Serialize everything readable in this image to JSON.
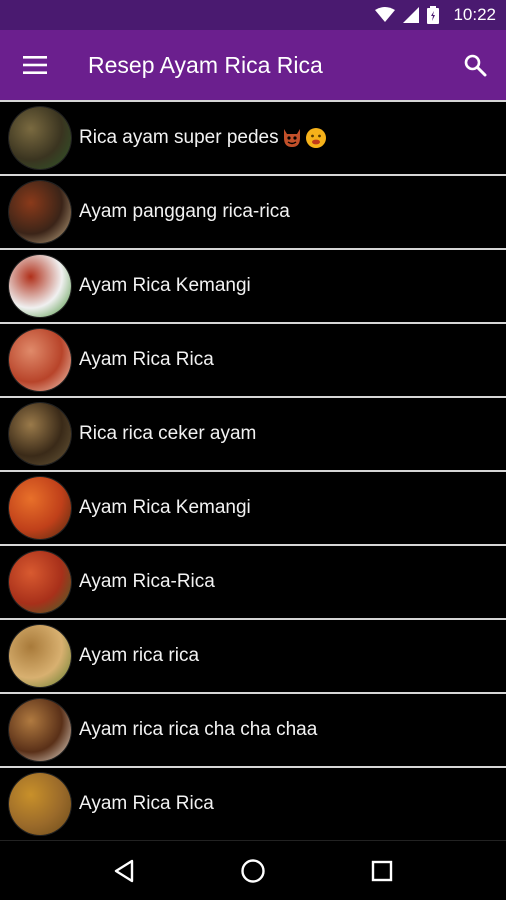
{
  "status_bar": {
    "time": "10:22",
    "icons": [
      "wifi-icon",
      "cell-signal-icon",
      "battery-icon"
    ]
  },
  "app_bar": {
    "title": "Resep Ayam Rica Rica",
    "left_icon": "menu-icon",
    "right_icon": "search-icon"
  },
  "recipes": [
    {
      "label": "Rica ayam super pedes",
      "trailing_emojis": [
        "devil-emoji-icon",
        "hot-face-emoji-icon"
      ],
      "thumb_colors": [
        "#3a3420",
        "#7a6a40",
        "#2f5a2a"
      ]
    },
    {
      "label": "Ayam panggang rica-rica",
      "thumb_colors": [
        "#3b2418",
        "#8a3a1a",
        "#c9b28a"
      ]
    },
    {
      "label": "Ayam Rica Kemangi",
      "thumb_colors": [
        "#f0f0f0",
        "#b0301a",
        "#3a8a2a"
      ]
    },
    {
      "label": "Ayam Rica Rica",
      "thumb_colors": [
        "#b8442a",
        "#e08a6a",
        "#f3d2c0"
      ]
    },
    {
      "label": "Rica rica ceker ayam",
      "thumb_colors": [
        "#3a2a18",
        "#9a7a4a",
        "#6a5a3a"
      ]
    },
    {
      "label": "Ayam Rica Kemangi",
      "thumb_colors": [
        "#c0401a",
        "#e8702a",
        "#4a2a10"
      ]
    },
    {
      "label": "Ayam Rica-Rica",
      "thumb_colors": [
        "#a8301a",
        "#d85a30",
        "#3a6a2a"
      ]
    },
    {
      "label": "Ayam rica rica",
      "thumb_colors": [
        "#d8b070",
        "#a87a3a",
        "#5a7a2a"
      ]
    },
    {
      "label": "Ayam rica rica cha cha chaa",
      "thumb_colors": [
        "#5a3018",
        "#b07a40",
        "#f0e8dc"
      ]
    },
    {
      "label": "Ayam Rica Rica",
      "thumb_colors": [
        "#9a6a2a",
        "#c8902a",
        "#6a4a1a"
      ]
    }
  ],
  "nav_bar": {
    "buttons": [
      "back-icon",
      "home-icon",
      "recents-icon"
    ]
  },
  "colors": {
    "status_bar": "#4a1a70",
    "app_bar": "#6b1f8e",
    "list_background": "#000000",
    "divider": "#d6d6d6",
    "text": "#f2f2f2"
  }
}
